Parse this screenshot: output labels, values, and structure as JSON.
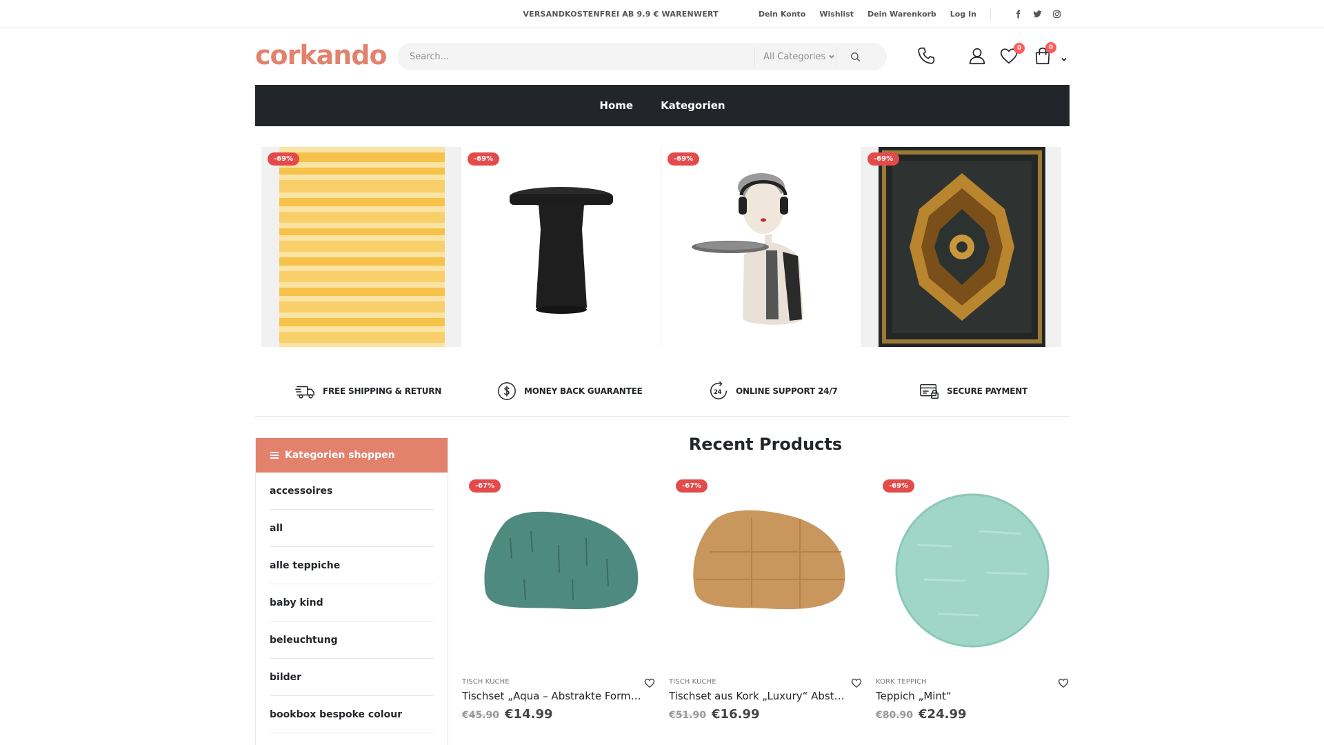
{
  "topbar": {
    "shipping": "VERSANDKOSTENFREI AB 9.9 € WARENWERT",
    "links": [
      "Dein Konto",
      "Wishlist",
      "Dein Warenkorb",
      "Log In"
    ],
    "social": [
      "facebook-icon",
      "twitter-icon",
      "instagram-icon"
    ]
  },
  "header": {
    "logo": "corkando",
    "search_placeholder": "Search...",
    "category_select": "All Categories",
    "wishlist_count": "0",
    "cart_count": "0"
  },
  "nav": {
    "items": [
      "Home",
      "Kategorien"
    ]
  },
  "hero": {
    "tiles": [
      {
        "badge": "-69%"
      },
      {
        "badge": "-69%"
      },
      {
        "badge": "-69%"
      },
      {
        "badge": "-69%"
      }
    ]
  },
  "features": [
    {
      "icon": "truck-icon",
      "label": "FREE SHIPPING & RETURN"
    },
    {
      "icon": "dollar-icon",
      "label": "MONEY BACK GUARANTEE"
    },
    {
      "icon": "support-24-icon",
      "label": "ONLINE SUPPORT 24/7"
    },
    {
      "icon": "secure-card-icon",
      "label": "SECURE PAYMENT"
    }
  ],
  "sidebar": {
    "title": "Kategorien shoppen",
    "items": [
      "accessoires",
      "all",
      "alle teppiche",
      "baby kind",
      "beleuchtung",
      "bilder",
      "bookbox bespoke colour"
    ]
  },
  "products": {
    "title": "Recent Products",
    "items": [
      {
        "badge": "-67%",
        "category": "TISCH KUCHE",
        "title": "Tischset „Aqua – Abstrakte Form I „, ...",
        "old_price": "€45.90",
        "price": "€14.99",
        "color": "#4f8a80"
      },
      {
        "badge": "-67%",
        "category": "TISCH KUCHE",
        "title": "Tischset aus Kork „Luxury“ Abstrakte...",
        "old_price": "€51.90",
        "price": "€16.99",
        "color": "#c9965e"
      },
      {
        "badge": "-69%",
        "category": "KORK TEPPICH",
        "title": "Teppich „Mint“",
        "old_price": "€80.90",
        "price": "€24.99",
        "color": "#9fd6c6"
      }
    ]
  },
  "colors": {
    "accent": "#e2826d",
    "dark": "#222529",
    "sale": "#e44a4a"
  }
}
